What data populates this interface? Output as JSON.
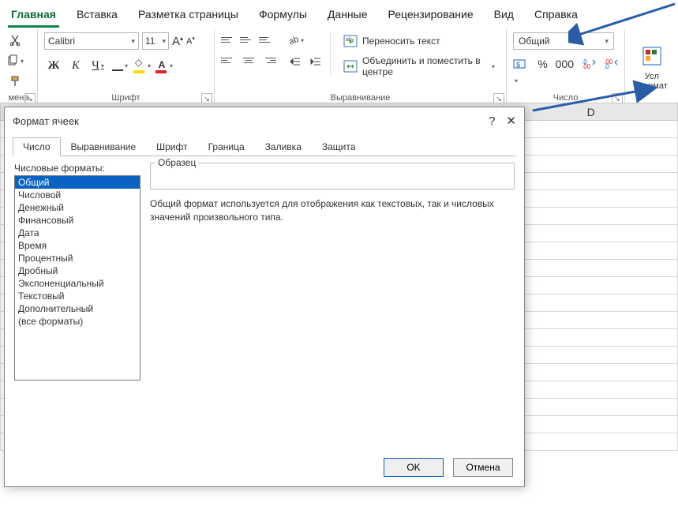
{
  "ribbon_tabs": {
    "home": "Главная",
    "insert": "Вставка",
    "page_layout": "Разметка страницы",
    "formulas": "Формулы",
    "data": "Данные",
    "review": "Рецензирование",
    "view": "Вид",
    "help": "Справка"
  },
  "clipboard": {
    "group_partial_label": "мена"
  },
  "font": {
    "name": "Calibri",
    "size": "11",
    "bold_glyph": "Ж",
    "italic_glyph": "К",
    "underline_glyph": "Ч",
    "group_label": "Шрифт",
    "color_glyph": "А"
  },
  "alignment": {
    "wrap_label": "Переносить текст",
    "merge_label": "Объединить и поместить в центре",
    "group_label": "Выравнивание"
  },
  "number": {
    "format_selected": "Общий",
    "percent_glyph": "%",
    "thousands_glyph": "000",
    "group_label": "Число"
  },
  "styles_partial": {
    "line1": "Усл",
    "line2": "формат"
  },
  "sheet": {
    "col_d": "D"
  },
  "dialog": {
    "title": "Формат ячеек",
    "help_glyph": "?",
    "close_glyph": "✕",
    "tabs": {
      "number": "Число",
      "alignment": "Выравнивание",
      "font": "Шрифт",
      "border": "Граница",
      "fill": "Заливка",
      "protection": "Защита"
    },
    "list_label": "Числовые форматы:",
    "formats": [
      "Общий",
      "Числовой",
      "Денежный",
      "Финансовый",
      "Дата",
      "Время",
      "Процентный",
      "Дробный",
      "Экспоненциальный",
      "Текстовый",
      "Дополнительный",
      "(все форматы)"
    ],
    "sample_label": "Образец",
    "description": "Общий формат используется для отображения как текстовых, так и числовых значений произвольного типа.",
    "ok": "OK",
    "cancel": "Отмена"
  }
}
